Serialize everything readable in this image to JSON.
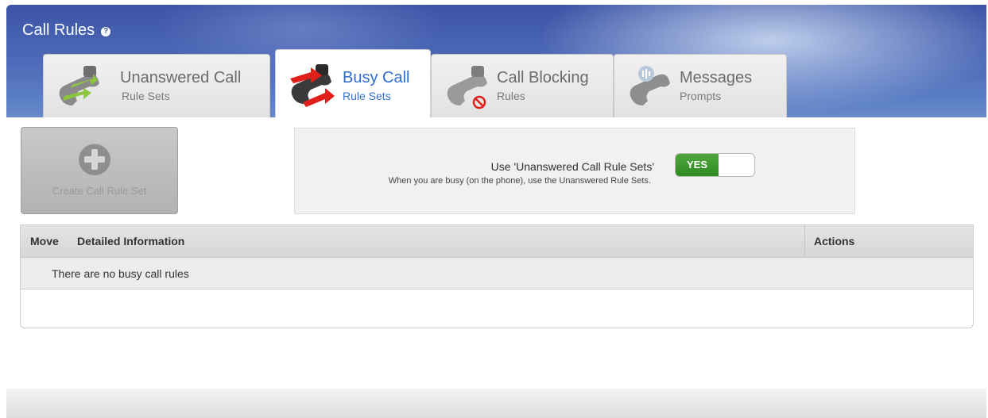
{
  "page": {
    "title": "Call Rules",
    "help_icon": "help-icon"
  },
  "tabs": [
    {
      "main": "Unanswered Call",
      "sub": "Rule Sets",
      "icon": "phone-forward-icon",
      "active": false
    },
    {
      "main": "Busy Call",
      "sub": "Rule Sets",
      "icon": "phone-busy-icon",
      "active": true
    },
    {
      "main": "Call Blocking",
      "sub": "Rules",
      "icon": "phone-block-icon",
      "active": false
    },
    {
      "main": "Messages",
      "sub": "Prompts",
      "icon": "phone-message-icon",
      "active": false
    }
  ],
  "create_button": {
    "label": "Create Call Rule Set",
    "icon": "plus-icon"
  },
  "option": {
    "title": "Use 'Unanswered Call Rule Sets'",
    "description": "When you are busy (on the phone), use the Unanswered Rule Sets.",
    "toggle_label": "YES",
    "toggle_state": "on"
  },
  "table": {
    "columns": [
      "Move",
      "Detailed Information",
      "Actions"
    ],
    "empty_message": "There are no busy call rules"
  },
  "colors": {
    "header_blue": "#3d55a6",
    "active_tab_text": "#2f6dd0",
    "toggle_green": "#3a9a2c"
  }
}
